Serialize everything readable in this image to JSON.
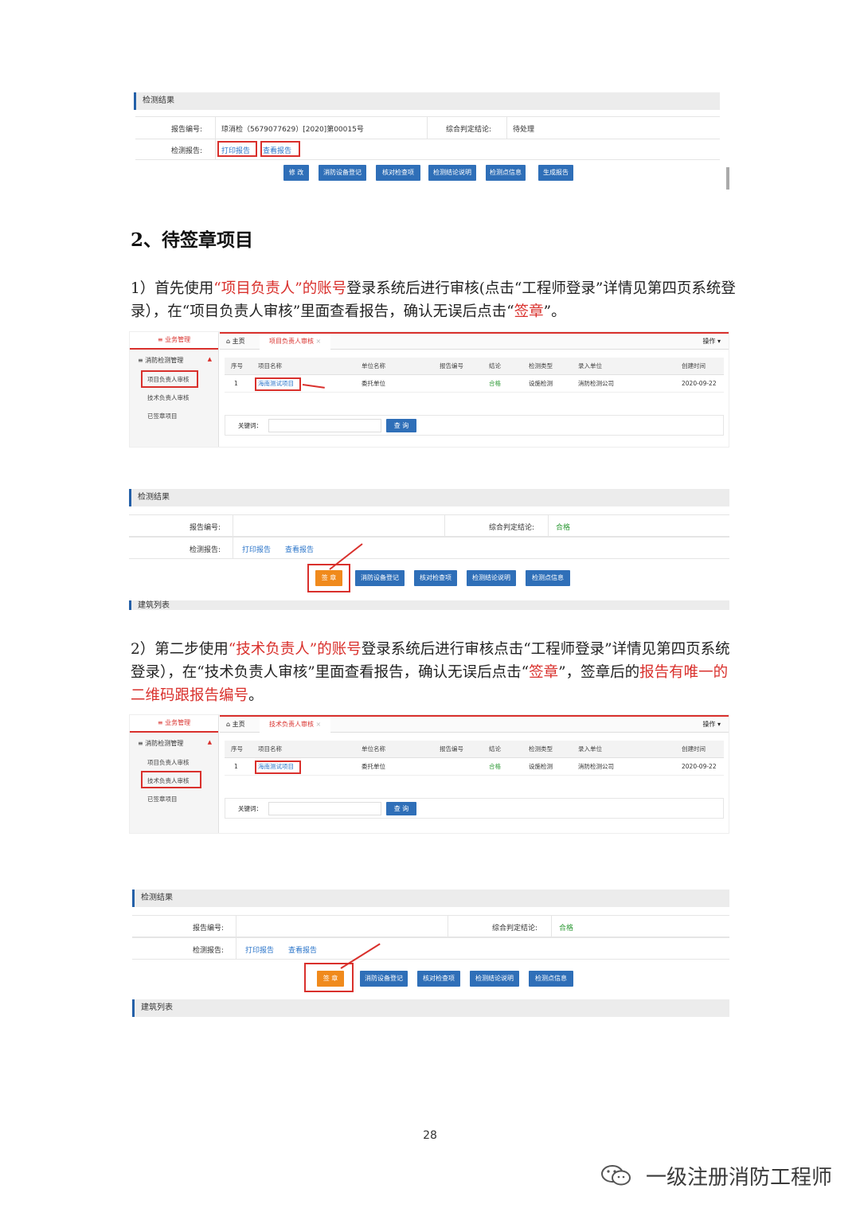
{
  "shot1": {
    "section_title": "检测结果",
    "report_no_label": "报告编号:",
    "report_no_value": "琼消检（5679077629）[2020]第00015号",
    "conclusion_label": "综合判定结论:",
    "conclusion_value": "待处理",
    "report_label": "检测报告:",
    "print_link": "打印报告",
    "view_link": "查看报告",
    "buttons": [
      "修 改",
      "消防设备登记",
      "核对检查项",
      "检测结论说明",
      "检测点信息",
      "生成报告"
    ]
  },
  "heading": "2、待签章项目",
  "para1": {
    "t1": "1）首先使用",
    "r1": "“项目负责人”的账号",
    "t2": "登录系统后进行审核(点击“工程师登录”详情见第四页系统登录），在“项目负责人审核”里面查看报告，确认无误后点击“",
    "r2": "签章",
    "t3": "”。"
  },
  "app1": {
    "side_top": "≡ 业务管理",
    "side_group": "≡ 消防检测管理",
    "side_items": [
      "项目负责人审核",
      "技术负责人审核",
      "已签章项目"
    ],
    "home_tab": "主页",
    "active_tab": "项目负责人审核",
    "ops": "操作 ▾",
    "columns": [
      "序号",
      "项目名称",
      "单位名称",
      "报告编号",
      "结论",
      "检测类型",
      "录入单位",
      "创建时间"
    ],
    "row": [
      "1",
      "海南测试项目",
      "委托单位",
      "",
      "合格",
      "设施检测",
      "消防检测公司",
      "2020-09-22"
    ],
    "keyword_label": "关键词：",
    "query_btn": "查 询"
  },
  "shot2": {
    "section_title": "检测结果",
    "report_no_label": "报告编号:",
    "conclusion_label": "综合判定结论:",
    "conclusion_value": "合格",
    "report_label": "检测报告:",
    "print_link": "打印报告",
    "view_link": "查看报告",
    "sign_btn": "签 章",
    "buttons": [
      "消防设备登记",
      "核对检查项",
      "检测结论说明",
      "检测点信息"
    ],
    "footer_title": "建筑列表"
  },
  "para2": {
    "t1": "2）第二步使用",
    "r1": "“技术负责人”的账号",
    "t2": "登录系统后进行审核点击“工程师登录”详情见第四页系统登录），在“技术负责人审核”里面查看报告，确认无误后点击“",
    "r2": "签章",
    "t3": "”，签章后的",
    "r3": "报告有唯一的二维码跟报告编号",
    "t4": "。"
  },
  "app2": {
    "side_top": "≡ 业务管理",
    "side_group": "≡ 消防检测管理",
    "side_items": [
      "项目负责人审核",
      "技术负责人审核",
      "已签章项目"
    ],
    "home_tab": "主页",
    "active_tab": "技术负责人审核",
    "ops": "操作 ▾",
    "columns": [
      "序号",
      "项目名称",
      "单位名称",
      "报告编号",
      "结论",
      "检测类型",
      "录入单位",
      "创建时间"
    ],
    "row": [
      "1",
      "海南测试项目",
      "委托单位",
      "",
      "合格",
      "设施检测",
      "消防检测公司",
      "2020-09-22"
    ],
    "keyword_label": "关键词：",
    "query_btn": "查 询"
  },
  "shot3": {
    "section_title": "检测结果",
    "report_no_label": "报告编号:",
    "conclusion_label": "综合判定结论:",
    "conclusion_value": "合格",
    "report_label": "检测报告:",
    "print_link": "打印报告",
    "view_link": "查看报告",
    "sign_btn": "签 章",
    "buttons": [
      "消防设备登记",
      "核对检查项",
      "检测结论说明",
      "检测点信息"
    ],
    "footer_title": "建筑列表"
  },
  "page_number": "28",
  "watermark": "一级注册消防工程师",
  "colors": {
    "accent_red": "#d9302c",
    "button_blue": "#2f6fb8",
    "sign_orange": "#f08a1c",
    "pass_green": "#2e9a36"
  }
}
